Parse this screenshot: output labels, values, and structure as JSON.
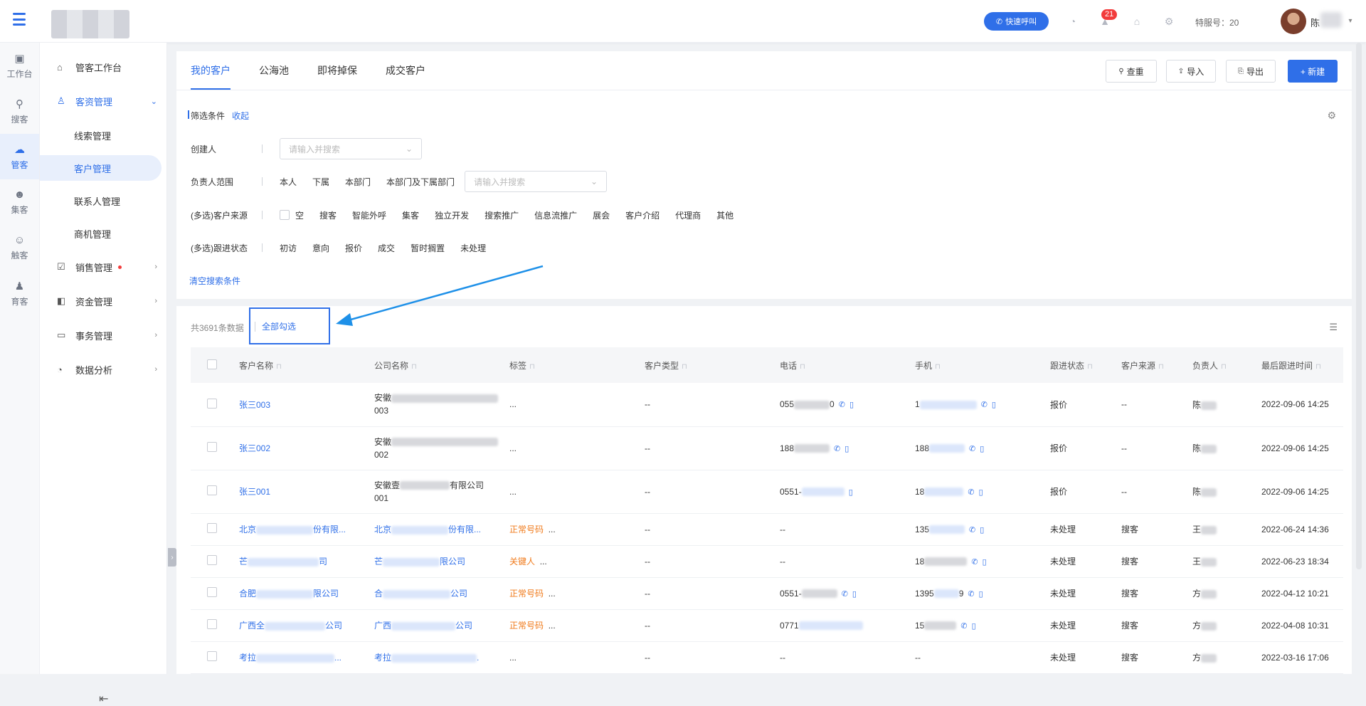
{
  "topbar": {
    "quick_call": "快速呼叫",
    "badge_count": "21",
    "service_no": "特服号：20",
    "user_name": "陈"
  },
  "rail": [
    {
      "label": "工作台",
      "icon": "desk-icon"
    },
    {
      "label": "搜客",
      "icon": "search-user-icon"
    },
    {
      "label": "管客",
      "icon": "crm-cloud-icon"
    },
    {
      "label": "集客",
      "icon": "group-icon"
    },
    {
      "label": "触客",
      "icon": "contact-icon"
    },
    {
      "label": "育客",
      "icon": "nurture-icon"
    }
  ],
  "sidebar": {
    "workbench": "管客工作台",
    "customer_mgmt": "客资管理",
    "leads": "线索管理",
    "customers": "客户管理",
    "contacts": "联系人管理",
    "opportunities": "商机管理",
    "sales": "销售管理",
    "funds": "资金管理",
    "affairs": "事务管理",
    "analytics": "数据分析"
  },
  "tabs": [
    "我的客户",
    "公海池",
    "即将掉保",
    "成交客户"
  ],
  "toolbar": {
    "dedupe": "查重",
    "import": "导入",
    "export": "导出",
    "create": "+ 新建"
  },
  "filters": {
    "title": "筛选条件",
    "collapse": "收起",
    "creator_label": "创建人",
    "creator_placeholder": "请输入并搜索",
    "owner_label": "负责人范围",
    "owner_options": [
      "本人",
      "下属",
      "本部门",
      "本部门及下属部门"
    ],
    "owner_placeholder": "请输入并搜索",
    "source_label": "(多选)客户来源",
    "source_options": [
      "空",
      "搜客",
      "智能外呼",
      "集客",
      "独立开发",
      "搜索推广",
      "信息流推广",
      "展会",
      "客户介绍",
      "代理商",
      "其他"
    ],
    "status_label": "(多选)跟进状态",
    "status_options": [
      "初访",
      "意向",
      "报价",
      "成交",
      "暂时搁置",
      "未处理"
    ],
    "clear": "清空搜索条件"
  },
  "list": {
    "count": "共3691条数据",
    "select_all": "全部勾选",
    "columns": [
      "客户名称",
      "公司名称",
      "标签",
      "客户类型",
      "电话",
      "手机",
      "跟进状态",
      "客户来源",
      "负责人",
      "最后跟进时间"
    ],
    "rows": [
      {
        "name": "张三003",
        "company": "安徽",
        "company2": "003",
        "tag": "...",
        "type": "--",
        "phone": "055",
        "phone_end": "0",
        "mobile": "1",
        "status": "报价",
        "source": "--",
        "owner": "陈",
        "time": "2022-09-06 14:25"
      },
      {
        "name": "张三002",
        "company": "安徽",
        "company2": "002",
        "tag": "...",
        "type": "--",
        "phone": "188",
        "phone_end": "",
        "mobile": "188",
        "status": "报价",
        "source": "--",
        "owner": "陈",
        "time": "2022-09-06 14:25"
      },
      {
        "name": "张三001",
        "company": "安徽壹",
        "company_end": "有限公司",
        "company2": "001",
        "tag": "...",
        "type": "--",
        "phone": "0551-",
        "phone_end": "",
        "mobile": "18",
        "status": "报价",
        "source": "--",
        "owner": "陈",
        "time": "2022-09-06 14:25"
      },
      {
        "name": "北京",
        "name_end": "份有限...",
        "company": "北京",
        "company_end": "份有限...",
        "tag": "正常号码",
        "tag_more": "...",
        "type": "--",
        "phone": "--",
        "mobile": "135",
        "status": "未处理",
        "source": "搜客",
        "owner": "王",
        "time": "2022-06-24 14:36"
      },
      {
        "name": "芒",
        "name_end": "司",
        "company": "芒",
        "company_end": "限公司",
        "tag": "关键人",
        "tag_more": "...",
        "type": "--",
        "phone": "--",
        "mobile": "18",
        "status": "未处理",
        "source": "搜客",
        "owner": "王",
        "time": "2022-06-23 18:34"
      },
      {
        "name": "合肥",
        "name_end": "限公司",
        "company": "合",
        "company_end": "公司",
        "tag": "正常号码",
        "tag_more": "...",
        "type": "--",
        "phone": "0551-",
        "phone_end": "",
        "mobile": "1395",
        "mobile_end": "9",
        "status": "未处理",
        "source": "搜客",
        "owner": "方",
        "time": "2022-04-12 10:21"
      },
      {
        "name": "广西全",
        "name_end": "公司",
        "company": "广西",
        "company_end": "公司",
        "tag": "正常号码",
        "tag_more": "...",
        "type": "--",
        "phone": "0771",
        "phone_end": "",
        "mobile": "15",
        "status": "未处理",
        "source": "搜客",
        "owner": "方",
        "time": "2022-04-08 10:31"
      },
      {
        "name": "考拉",
        "name_end": "...",
        "company": "考拉",
        "company_end": ".",
        "tag": "...",
        "type": "--",
        "phone": "--",
        "mobile": "--",
        "status": "未处理",
        "source": "搜客",
        "owner": "方",
        "time": "2022-03-16 17:06"
      }
    ]
  },
  "colors": {
    "primary": "#2f6fe8",
    "tag_orange": "#f07b1c",
    "badge_red": "#f23c3c",
    "arrow": "#1e90e8"
  }
}
